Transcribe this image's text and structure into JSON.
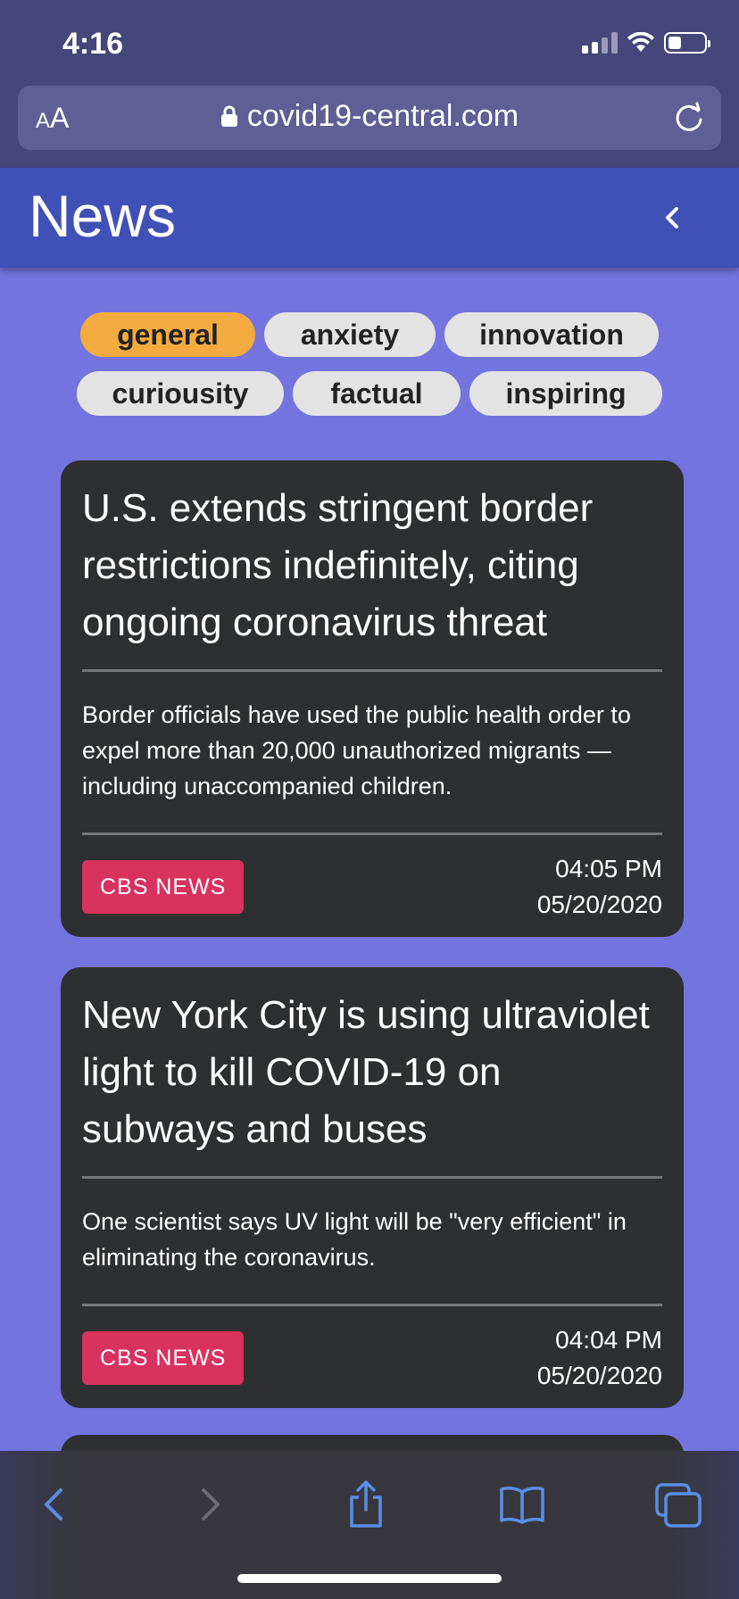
{
  "status_bar": {
    "time": "4:16"
  },
  "browser": {
    "aa_label_small": "A",
    "aa_label_large": "A",
    "url": "covid19-central.com"
  },
  "header": {
    "title": "News"
  },
  "categories": [
    {
      "label": "general",
      "active": true
    },
    {
      "label": "anxiety",
      "active": false
    },
    {
      "label": "innovation",
      "active": false
    },
    {
      "label": "curiousity",
      "active": false
    },
    {
      "label": "factual",
      "active": false
    },
    {
      "label": "inspiring",
      "active": false
    }
  ],
  "articles": [
    {
      "headline": "U.S. extends stringent border restrictions indefinitely, citing ongoing coronavirus threat",
      "summary": "Border officials have used the public health order to expel more than 20,000 unauthorized migrants — including unaccompanied children.",
      "source": "CBS NEWS",
      "time": "04:05 PM",
      "date": "05/20/2020"
    },
    {
      "headline": "New York City is using ultraviolet light to kill COVID-19 on subways and buses",
      "summary": "One scientist says UV light will be \"very efficient\" in eliminating the coronavirus.",
      "source": "CBS NEWS",
      "time": "04:04 PM",
      "date": "05/20/2020"
    }
  ],
  "icons": {
    "lock": "lock-icon",
    "reload": "reload-icon",
    "back": "chevron-left-icon",
    "toolbar": [
      "back-arrow-icon",
      "forward-arrow-icon",
      "share-icon",
      "bookmarks-icon",
      "tabs-icon"
    ]
  },
  "colors": {
    "background": "#7474e0",
    "header": "#4050b6",
    "chip_active": "#f3ab3f",
    "chip": "#e3e3e3",
    "card": "#2e2f31",
    "source_badge": "#d8325f",
    "toolbar_accent": "#5a8ee6"
  }
}
